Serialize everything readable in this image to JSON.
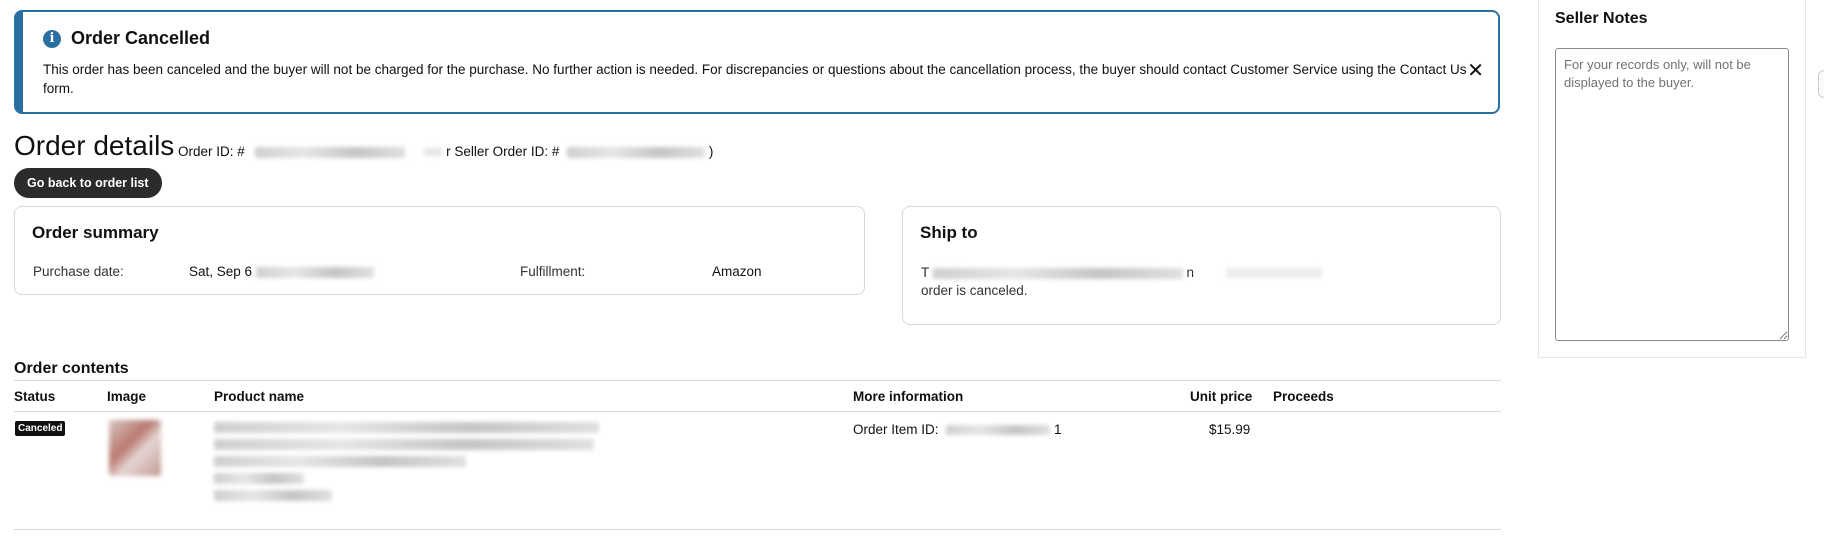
{
  "alert": {
    "title": "Order Cancelled",
    "icon": "info-icon",
    "body": "This order has been canceled and the buyer will not be charged for the purchase. No further action is needed. For discrepancies or questions about the cancellation process, the buyer should contact Customer Service using the Contact Us form.",
    "close_glyph": "✕"
  },
  "header": {
    "title": "Order details",
    "order_id_label": "Order ID: #",
    "seller_order_id_label": "r Seller Order ID: #",
    "seller_order_id_close": ")",
    "back_button": "Go back to order list"
  },
  "summary": {
    "title": "Order summary",
    "purchase_date_label": "Purchase date:",
    "purchase_date_value": "Sat, Sep 6",
    "fulfillment_label": "Fulfillment:",
    "fulfillment_value": "Amazon"
  },
  "ship_to": {
    "title": "Ship to",
    "line1_prefix": "T",
    "line1_suffix": "n",
    "line2": "order is canceled."
  },
  "seller_notes": {
    "title": "Seller Notes",
    "placeholder": "For your records only, will not be displayed to the buyer."
  },
  "contents": {
    "title": "Order contents",
    "columns": [
      "Status",
      "Image",
      "Product name",
      "More information",
      "Unit price",
      "Proceeds"
    ],
    "rows": [
      {
        "status": "Canceled",
        "order_item_label": "Order Item ID:",
        "order_item_suffix": "1",
        "unit_price": "$15.99",
        "proceeds": ""
      }
    ]
  }
}
